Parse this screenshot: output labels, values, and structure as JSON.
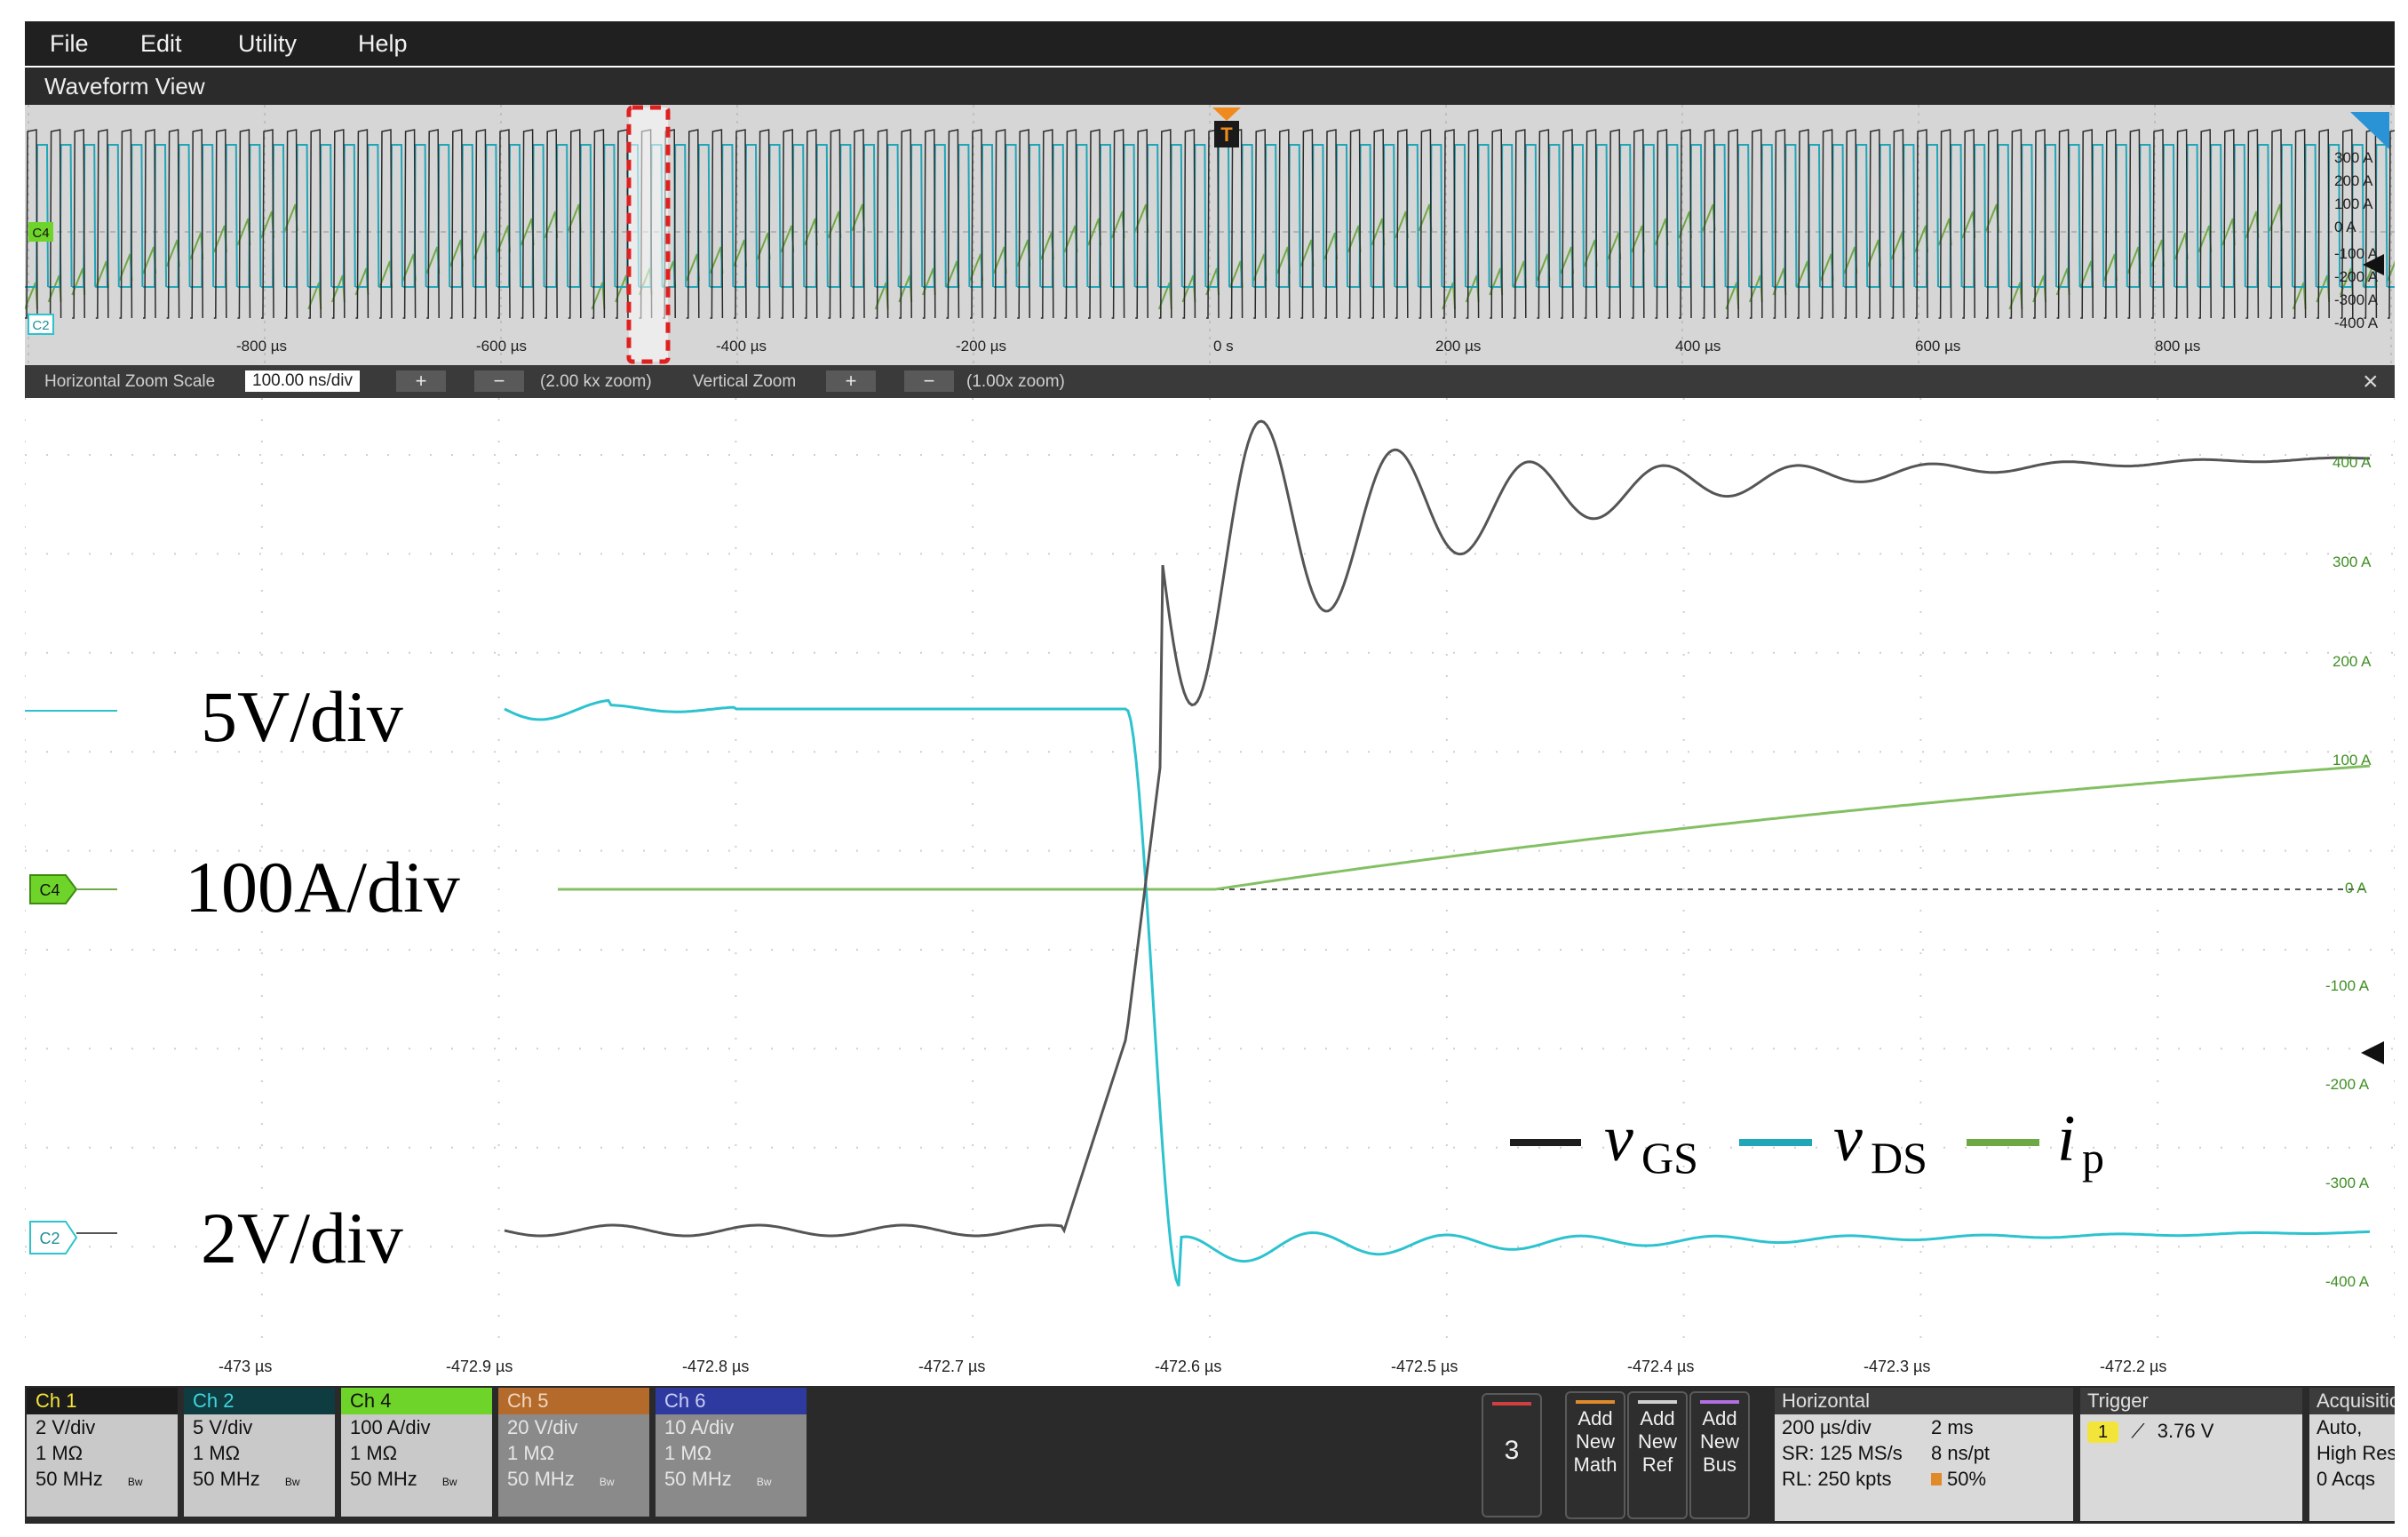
{
  "menu": {
    "items": [
      "File",
      "Edit",
      "Utility",
      "Help"
    ]
  },
  "waveform_view": {
    "title": "Waveform View"
  },
  "overview": {
    "time_labels": [
      "-800 µs",
      "-600 µs",
      "-400 µs",
      "-200 µs",
      "0 s",
      "200 µs",
      "400 µs",
      "600 µs",
      "800 µs"
    ],
    "right_labels": [
      "300 A",
      "200 A",
      "100 A",
      "0 A",
      "-100 A",
      "-200 A",
      "-300 A",
      "-400 A"
    ],
    "trigger_marker": "T",
    "c4_tag": "C4",
    "c2_tag": "C2"
  },
  "zoom_bar": {
    "hz_label": "Horizontal Zoom Scale",
    "hz_value": "100.00 ns/div",
    "hz_factor": "(2.00 kx zoom)",
    "vz_label": "Vertical Zoom",
    "vz_factor": "(1.00x zoom)",
    "plus": "+",
    "minus": "−",
    "close": "×"
  },
  "main_plot": {
    "y_tick_labels": [
      "400 A",
      "300 A",
      "200 A",
      "100 A",
      "0 A",
      "-100 A",
      "-200 A",
      "-300 A",
      "-400 A"
    ],
    "x_tick_labels": [
      "-473 µs",
      "-472.9 µs",
      "-472.8 µs",
      "-472.7 µs",
      "-472.6 µs",
      "-472.5 µs",
      "-472.4 µs",
      "-472.3 µs",
      "-472.2 µs"
    ],
    "scale_labels": {
      "vds": "5V/div",
      "ip": "100A/div",
      "vgs": "2V/div"
    },
    "marker_c4": "C4",
    "marker_c2": "C2",
    "legend": [
      {
        "symbol": "v",
        "sub": "GS",
        "color": "#1e1e1e"
      },
      {
        "symbol": "v",
        "sub": "DS",
        "color": "#1fa6b8"
      },
      {
        "symbol": "i",
        "sub": "p",
        "color": "#6ea845"
      }
    ],
    "colors": {
      "vgs": "#555555",
      "vds": "#2cc3cf",
      "ip": "#84c063",
      "grid": "#c8c8c8"
    }
  },
  "channels": [
    {
      "name": "Ch 1",
      "head_bg": "#1c1c1c",
      "head_fg": "#f3e43a",
      "lines": [
        "2 V/div",
        "1 MΩ",
        "50 MHz"
      ]
    },
    {
      "name": "Ch 2",
      "head_bg": "#0f3c40",
      "head_fg": "#3fd6e0",
      "lines": [
        "5 V/div",
        "1 MΩ",
        "50 MHz"
      ]
    },
    {
      "name": "Ch 4",
      "head_bg": "#6fd42a",
      "head_fg": "#111111",
      "lines": [
        "100 A/div",
        "1 MΩ",
        "50 MHz"
      ]
    },
    {
      "name": "Ch 5",
      "head_bg": "#b36a2a",
      "head_fg": "#f0d6c0",
      "lines": [
        "20 V/div",
        "1 MΩ",
        "50 MHz"
      ]
    },
    {
      "name": "Ch 6",
      "head_bg": "#2f3aa0",
      "head_fg": "#c9cdf5",
      "lines": [
        "10 A/div",
        "1 MΩ",
        "50 MHz"
      ]
    }
  ],
  "bw_icon": "Bw",
  "counter_button": {
    "label": "3"
  },
  "add_buttons": [
    {
      "lines": [
        "Add",
        "New",
        "Math"
      ],
      "color": "#e08a2a"
    },
    {
      "lines": [
        "Add",
        "New",
        "Ref"
      ],
      "color": "#d0d0d0"
    },
    {
      "lines": [
        "Add",
        "New",
        "Bus"
      ],
      "color": "#b070e0"
    }
  ],
  "horizontal": {
    "title": "Horizontal",
    "col1": [
      "200 µs/div",
      "SR: 125 MS/s",
      "RL: 250 kpts"
    ],
    "col2": [
      "2 ms",
      "8 ns/pt",
      "50%"
    ]
  },
  "trigger": {
    "title": "Trigger",
    "source": "1",
    "level": "3.76 V"
  },
  "acquisition": {
    "title": "Acquisitio",
    "lines": [
      "Auto,",
      "High Res:",
      "0 Acqs"
    ]
  }
}
